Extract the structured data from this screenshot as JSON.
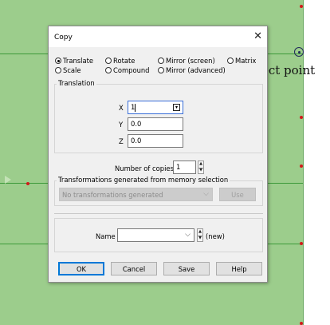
{
  "canvas": {
    "select_point_label": "Select point",
    "background_color": "#9ccd8c",
    "line_color": "#3d9a3a",
    "point_color": "#d21a1a"
  },
  "dialog": {
    "title": "Copy",
    "close_glyph": "✕",
    "mode_options": [
      {
        "label": "Translate",
        "selected": true
      },
      {
        "label": "Rotate",
        "selected": false
      },
      {
        "label": "Mirror (screen)",
        "selected": false
      },
      {
        "label": "Matrix",
        "selected": false
      },
      {
        "label": "Scale",
        "selected": false
      },
      {
        "label": "Compound",
        "selected": false
      },
      {
        "label": "Mirror (advanced)",
        "selected": false
      }
    ],
    "translation": {
      "group_label": "Translation",
      "x_label": "X",
      "x_value": "1",
      "y_label": "Y",
      "y_value": "0.0",
      "z_label": "Z",
      "z_value": "0.0"
    },
    "copies": {
      "label": "Number of copies",
      "value": "1"
    },
    "memory": {
      "group_label": "Transformations generated from memory selection",
      "combo_value": "No transformations generated",
      "use_button": "Use"
    },
    "name": {
      "label": "Name",
      "value": "",
      "suffix": "(new)"
    },
    "buttons": {
      "ok": "OK",
      "cancel": "Cancel",
      "save": "Save",
      "help": "Help"
    },
    "accent_color": "#0078d7"
  }
}
